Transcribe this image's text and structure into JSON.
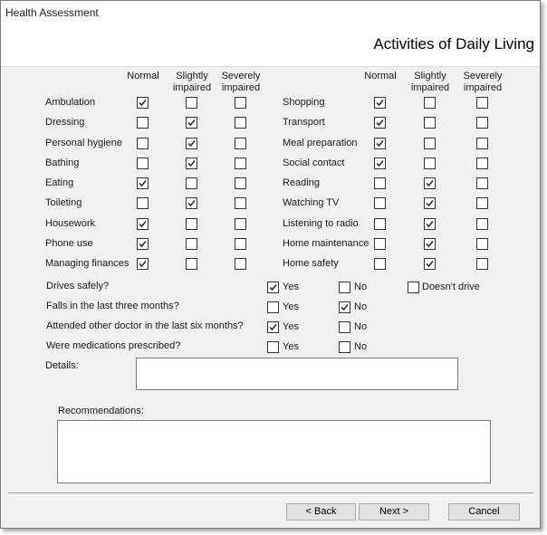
{
  "window": {
    "title": "Health Assessment"
  },
  "header": {
    "heading": "Activities of Daily Living"
  },
  "columns": [
    "Normal",
    "Slightly impaired",
    "Severely impaired"
  ],
  "adl_left": [
    {
      "label": "Ambulation",
      "checked": 0
    },
    {
      "label": "Dressing",
      "checked": 1
    },
    {
      "label": "Personal hygiene",
      "checked": 1
    },
    {
      "label": "Bathing",
      "checked": 1
    },
    {
      "label": "Eating",
      "checked": 0
    },
    {
      "label": "Toileting",
      "checked": 1
    },
    {
      "label": "Housework",
      "checked": 0
    },
    {
      "label": "Phone use",
      "checked": 0
    },
    {
      "label": "Managing finances",
      "checked": 0
    }
  ],
  "adl_right": [
    {
      "label": "Shopping",
      "checked": 0
    },
    {
      "label": "Transport",
      "checked": 0
    },
    {
      "label": "Meal preparation",
      "checked": 0
    },
    {
      "label": "Social contact",
      "checked": 0
    },
    {
      "label": "Reading",
      "checked": 1
    },
    {
      "label": "Watching TV",
      "checked": 1
    },
    {
      "label": "Listening to radio",
      "checked": 1
    },
    {
      "label": "Home maintenance",
      "checked": 1
    },
    {
      "label": "Home safety",
      "checked": 1
    }
  ],
  "questions": [
    {
      "label": "Drives safely?",
      "yes": true,
      "no": false,
      "extra_label": "Doesn't drive",
      "extra": false
    },
    {
      "label": "Falls in the last three months?",
      "yes": false,
      "no": true
    },
    {
      "label": "Attended other doctor in the last six months?",
      "yes": true,
      "no": false
    },
    {
      "label": "Were medications prescribed?",
      "yes": false,
      "no": false
    }
  ],
  "yes_label": "Yes",
  "no_label": "No",
  "details": {
    "label": "Details:",
    "value": ""
  },
  "recommendations": {
    "label": "Recommendations:",
    "value": ""
  },
  "buttons": {
    "back": "< Back",
    "next": "Next >",
    "cancel": "Cancel"
  }
}
